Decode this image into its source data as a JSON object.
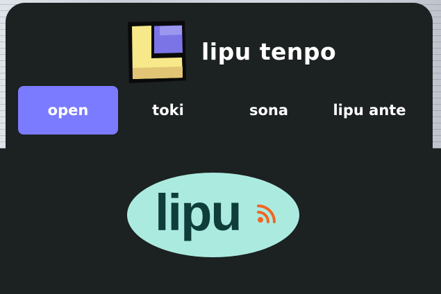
{
  "app": {
    "title": "lipu tenpo",
    "logo_icon": "lipu-tenpo-logo-icon"
  },
  "nav": {
    "tabs": [
      {
        "label": "open",
        "active": true
      },
      {
        "label": "toki",
        "active": false
      },
      {
        "label": "sona",
        "active": false
      },
      {
        "label": "lipu ante",
        "active": false
      }
    ]
  },
  "hero": {
    "wordmark": "lipu",
    "feed_icon": "rss-icon"
  },
  "colors": {
    "background": "#1c2121",
    "active_tab": "#7b7bff",
    "hero_pill": "#abebdf",
    "hero_text": "#0f3d3a",
    "rss": "#f26522",
    "logo_yellow": "#f7e889",
    "logo_purple": "#7b74e6"
  }
}
